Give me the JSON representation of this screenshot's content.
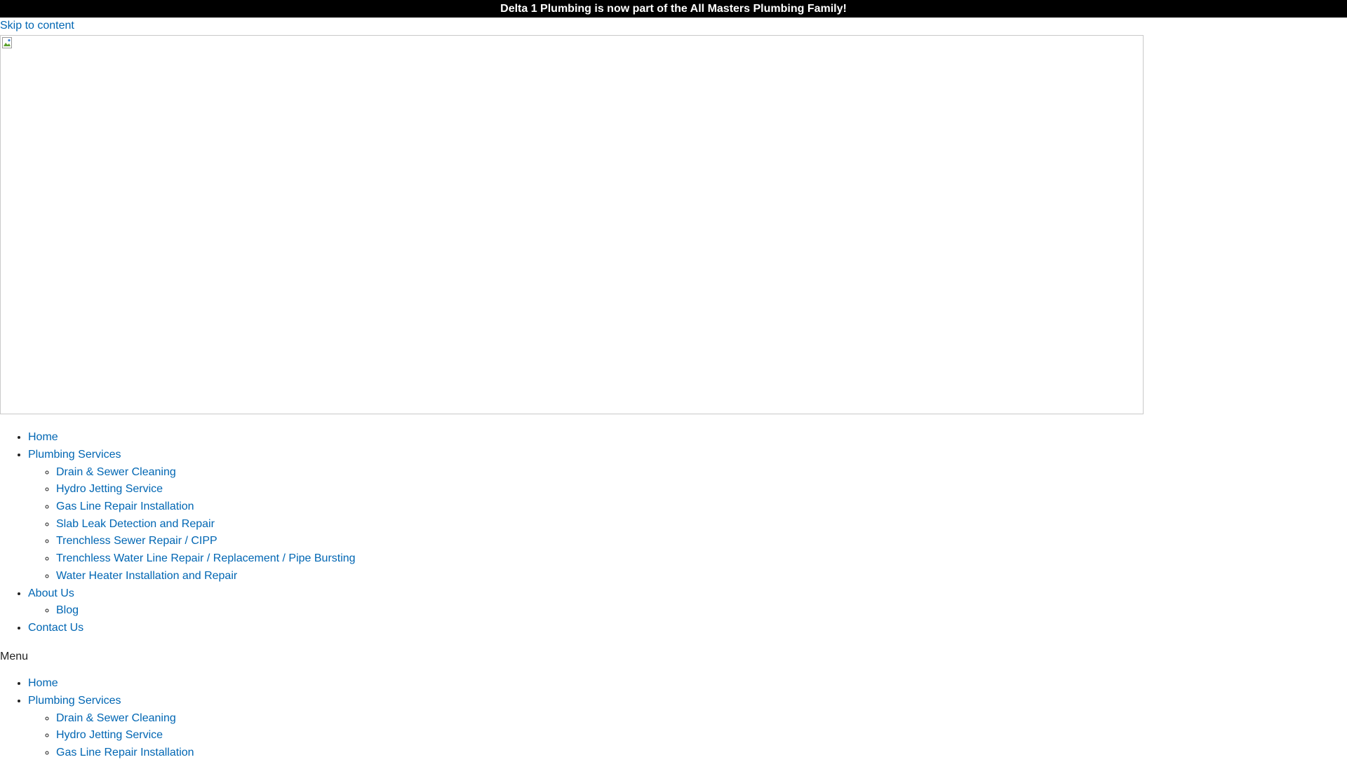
{
  "announcement": "Delta 1 Plumbing is now part of the All Masters Plumbing Family!",
  "skip_link": "Skip to content",
  "hero": {
    "icon": "broken-image-icon"
  },
  "colors": {
    "link": "#0066b3",
    "bar_bg": "#000000",
    "bar_text": "#ffffff"
  },
  "primary_menu": {
    "home": "Home",
    "plumbing": "Plumbing Services",
    "plumbing_items": [
      "Drain & Sewer Cleaning",
      "Hydro Jetting Service",
      "Gas Line Repair Installation",
      "Slab Leak Detection and Repair",
      "Trenchless Sewer Repair / CIPP",
      "Trenchless Water Line Repair / Replacement / Pipe Bursting",
      "Water Heater Installation and Repair"
    ],
    "about": "About Us",
    "about_items": [
      "Blog"
    ],
    "contact": "Contact Us"
  },
  "menu_label": "Menu",
  "mobile_menu": {
    "home": "Home",
    "plumbing": "Plumbing Services",
    "plumbing_items": [
      "Drain & Sewer Cleaning",
      "Hydro Jetting Service",
      "Gas Line Repair Installation"
    ]
  }
}
